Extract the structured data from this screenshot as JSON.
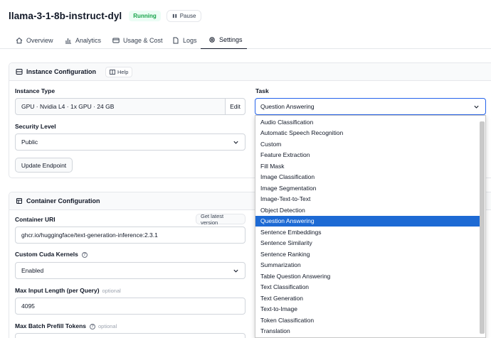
{
  "header": {
    "title": "llama-3-1-8b-instruct-dyl",
    "status": "Running",
    "pause_label": "Pause"
  },
  "tabs": [
    {
      "label": "Overview",
      "icon": "home-icon"
    },
    {
      "label": "Analytics",
      "icon": "bar-chart-icon"
    },
    {
      "label": "Usage & Cost",
      "icon": "credit-card-icon"
    },
    {
      "label": "Logs",
      "icon": "file-icon"
    },
    {
      "label": "Settings",
      "icon": "gear-icon"
    }
  ],
  "active_tab": "Settings",
  "instance_config": {
    "title": "Instance Configuration",
    "help_label": "Help",
    "instance_type_label": "Instance Type",
    "instance_type_value": "GPU · Nvidia L4 · 1x GPU · 24 GB",
    "edit_label": "Edit",
    "security_label": "Security Level",
    "security_value": "Public",
    "update_label": "Update Endpoint",
    "task_label": "Task",
    "task_value": "Question Answering"
  },
  "task_options": [
    "Audio Classification",
    "Automatic Speech Recognition",
    "Custom",
    "Feature Extraction",
    "Fill Mask",
    "Image Classification",
    "Image Segmentation",
    "Image-Text-to-Text",
    "Object Detection",
    "Question Answering",
    "Sentence Embeddings",
    "Sentence Similarity",
    "Sentence Ranking",
    "Summarization",
    "Table Question Answering",
    "Text Classification",
    "Text Generation",
    "Text-to-Image",
    "Token Classification",
    "Translation"
  ],
  "selected_task_index": 9,
  "container_config": {
    "title": "Container Configuration",
    "uri_label": "Container URI",
    "latest_label": "Get latest version",
    "uri_value": "ghcr.io/huggingface/text-generation-inference:2.3.1",
    "cuda_label": "Custom Cuda Kernels",
    "cuda_value": "Enabled",
    "max_input_label": "Max Input Length (per Query)",
    "optional_label": "optional",
    "max_input_value": "4095",
    "max_batch_label": "Max Batch Prefill Tokens"
  },
  "colors": {
    "accent": "#1d6ad4",
    "running": "#16a34a"
  }
}
